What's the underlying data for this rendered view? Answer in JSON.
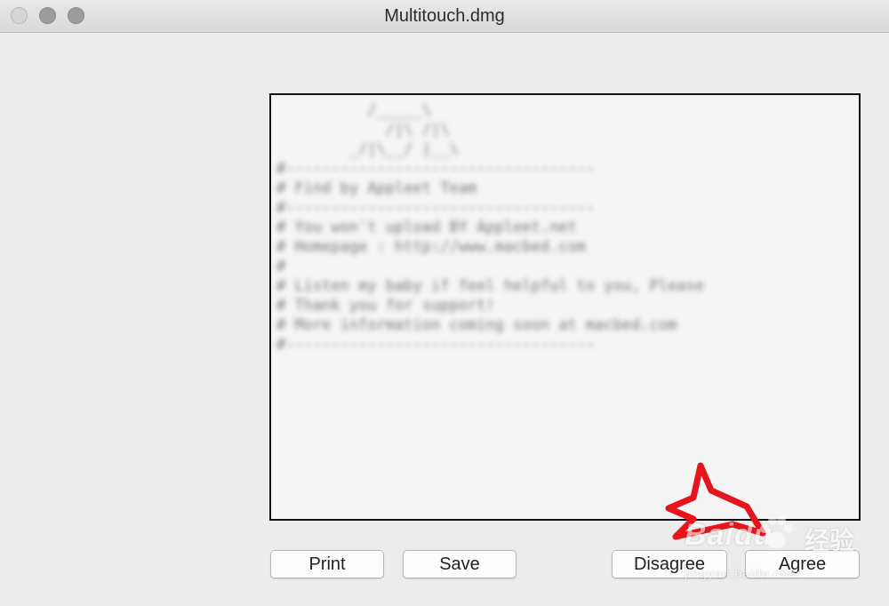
{
  "window": {
    "title": "Multitouch.dmg"
  },
  "license": {
    "text": "          /_____\\\n            /|\\ /|\\\n        _/|\\__/ |__\\\n#----------------------------------\n# Find by Appleet Team\n#----------------------------------\n# You won't upload BY Appleet.net\n# Homepage : http://www.macbed.com\n#\n# Listen my baby if feel helpful to you, Please\n# Thank you for support!\n# More information coming soon at macbed.com\n#----------------------------------"
  },
  "buttons": {
    "print": "Print",
    "save": "Save",
    "disagree": "Disagree",
    "agree": "Agree"
  },
  "watermark": {
    "brand": "Baidu",
    "cn": "经验",
    "url": "jingyan.baidu.com"
  },
  "colors": {
    "window_bg": "#ececec",
    "text_area_bg": "#f5f5f5",
    "annotation": "#e8141b"
  }
}
